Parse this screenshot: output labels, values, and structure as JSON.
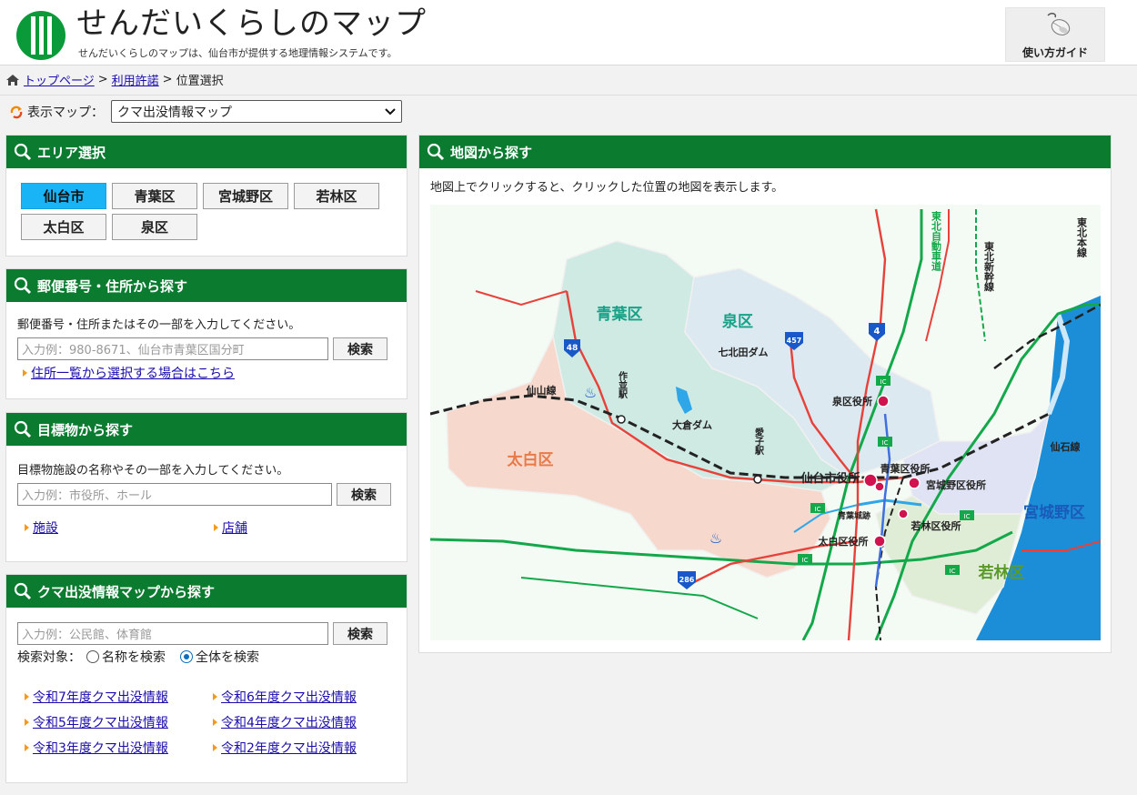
{
  "header": {
    "site_title": "せんだいくらしのマップ",
    "site_subtitle": "せんだいくらしのマップは、仙台市が提供する地理情報システムです。",
    "guide_label": "使い方ガイド"
  },
  "breadcrumb": {
    "items": [
      "トップページ",
      "利用許諾",
      "位置選択"
    ],
    "separator": ">"
  },
  "map_select": {
    "label": "表示マップ：",
    "selected": "クマ出没情報マップ"
  },
  "area_panel": {
    "title": "エリア選択",
    "buttons": [
      "仙台市",
      "青葉区",
      "宮城野区",
      "若林区",
      "太白区",
      "泉区"
    ],
    "active": "仙台市"
  },
  "postal_panel": {
    "title": "郵便番号・住所から探す",
    "description": "郵便番号・住所またはその一部を入力してください。",
    "placeholder": "入力例：980-8671、仙台市青葉区国分町",
    "search_label": "検索",
    "link": "住所一覧から選択する場合はこちら"
  },
  "landmark_panel": {
    "title": "目標物から探す",
    "description": "目標物施設の名称やその一部を入力してください。",
    "placeholder": "入力例：市役所、ホール",
    "search_label": "検索",
    "links": [
      "施設",
      "店舗"
    ]
  },
  "bear_panel": {
    "title": "クマ出没情報マップから探す",
    "placeholder": "入力例：公民館、体育館",
    "search_label": "検索",
    "target_label": "検索対象：",
    "radio_name": "名称を検索",
    "radio_all": "全体を検索",
    "selected_radio": "全体を検索",
    "links": [
      "令和7年度クマ出没情報",
      "令和6年度クマ出没情報",
      "令和5年度クマ出没情報",
      "令和4年度クマ出没情報",
      "令和3年度クマ出没情報",
      "令和2年度クマ出没情報"
    ]
  },
  "map_panel": {
    "title": "地図から探す",
    "description": "地図上でクリックすると、クリックした位置の地図を表示します。",
    "labels": {
      "aoba": "青葉区",
      "izumi": "泉区",
      "taihaku": "太白区",
      "miyagino": "宮城野区",
      "wakabayashi": "若林区",
      "city_hall": "仙台市役所",
      "izumi_office": "泉区役所",
      "aoba_office": "青葉区役所",
      "miyagino_office": "宮城野区役所",
      "wakabayashi_office": "若林区役所",
      "taihaku_office": "太白区役所",
      "nanakita_dam": "七北田ダム",
      "okura_dam": "大倉ダム",
      "senzan_line": "仙山線",
      "senseki_line": "仙石線",
      "sakunami_st": "作並駅",
      "ayashi_st": "愛子駅",
      "aoba_castle": "青葉城跡",
      "tohoku_expressway": "東北自動車道",
      "tohoku_shinkansen": "東北新幹線",
      "tohoku_main_line": "東北本線",
      "route_48": "48",
      "route_457": "457",
      "route_4": "4",
      "route_286": "286",
      "ic": "IC"
    }
  },
  "colors": {
    "header_green": "#0b7c2f",
    "active_blue": "#19b4f5",
    "aoba_fill": "#cfe9e3",
    "izumi_fill": "#dce9f0",
    "taihaku_fill": "#f6d9cc",
    "miyagino_fill": "#dfe3f3",
    "wakabayashi_fill": "#e0edd6",
    "sea": "#1c8ed8"
  },
  "icons": [
    "logo-icon",
    "mouse-icon",
    "home-icon",
    "refresh-icon",
    "search-icon",
    "chevron-down-icon"
  ]
}
